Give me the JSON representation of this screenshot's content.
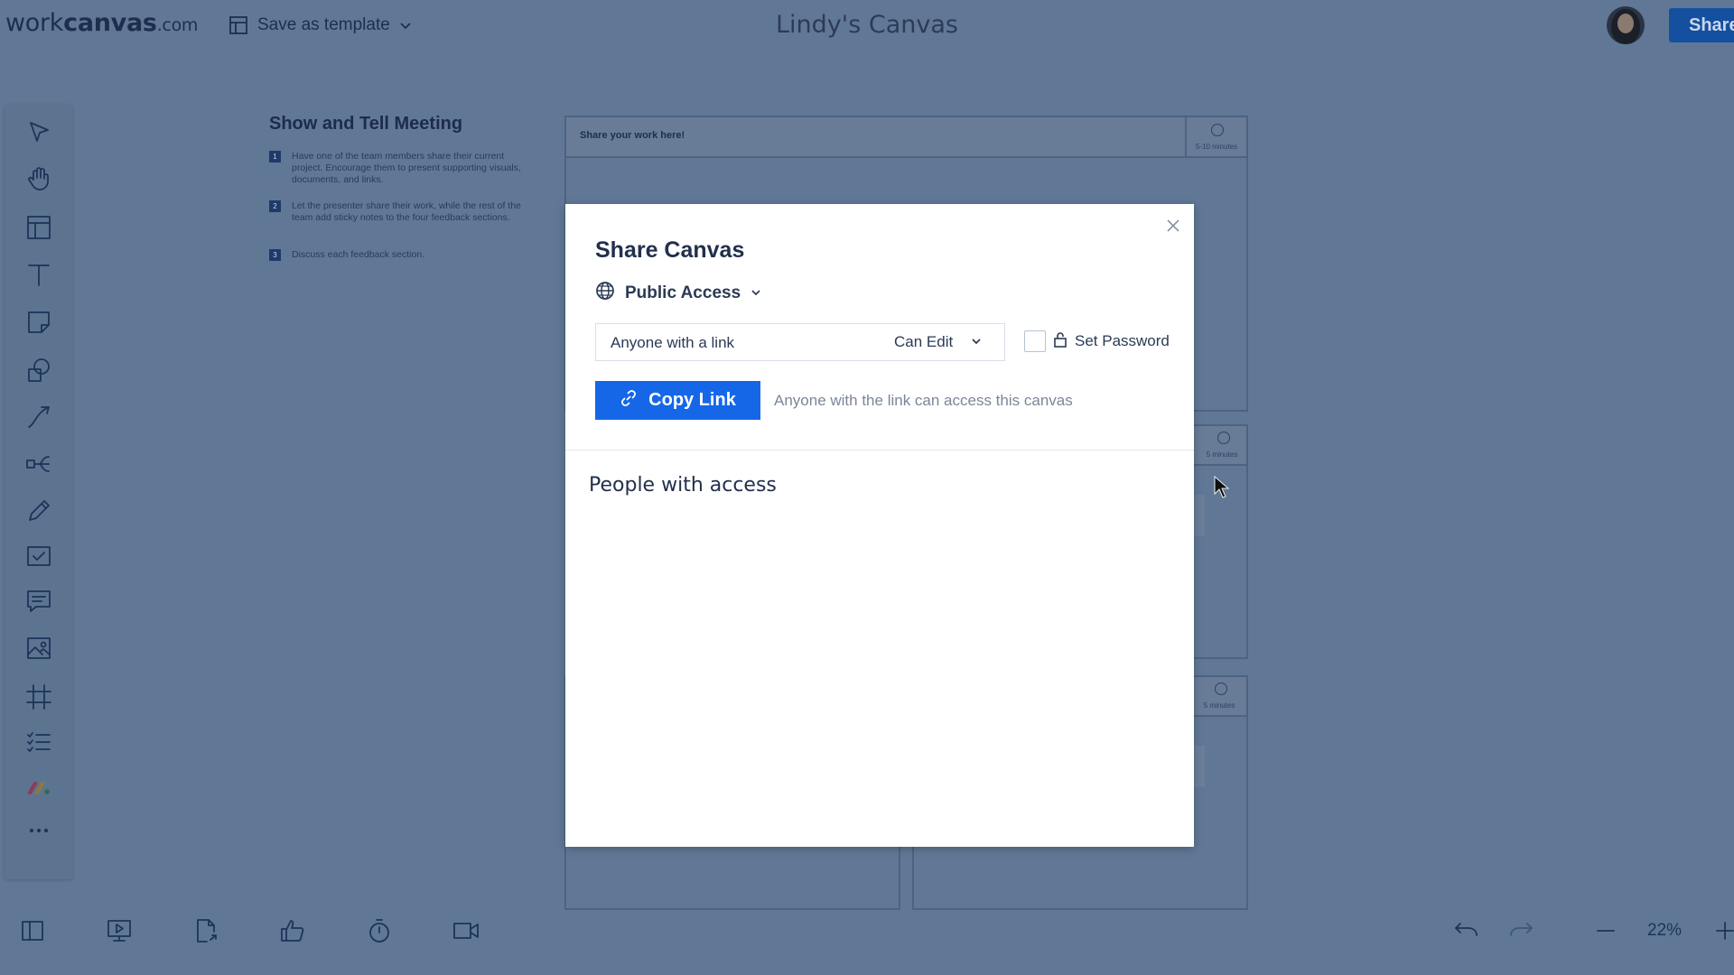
{
  "header": {
    "logo_main": "work",
    "logo_bold": "canvas",
    "logo_domain": ".com",
    "save_template_label": "Save as template",
    "canvas_title": "Lindy's Canvas",
    "share_label": "Share"
  },
  "board": {
    "title": "Show and Tell Meeting",
    "steps": [
      {
        "num": "1",
        "text": "Have one of the team members share their current project. Encourage them to present supporting visuals, documents, and links."
      },
      {
        "num": "2",
        "text": "Let the presenter share their work, while the rest of the team add sticky notes to the four feedback sections."
      },
      {
        "num": "3",
        "text": "Discuss each feedback section."
      }
    ],
    "share_hint": "Share your work here!",
    "timer_1": "5-10 minutes",
    "timer_2": "5 minutes",
    "timer_3": "5 minutes"
  },
  "toolbar": {
    "icons": [
      "select-icon",
      "hand-icon",
      "template-icon",
      "text-icon",
      "sticky-note-icon",
      "shapes-icon",
      "connector-icon",
      "mind-map-icon",
      "pen-icon",
      "task-icon",
      "comment-icon",
      "image-icon",
      "frame-icon",
      "list-icon",
      "apps-icon",
      "more-icon"
    ]
  },
  "bottom": {
    "icons": [
      "panel-icon",
      "present-icon",
      "export-icon",
      "vote-icon",
      "timer-icon",
      "video-icon",
      "undo-icon",
      "redo-icon",
      "zoom-out-icon",
      "zoom-in-icon"
    ],
    "zoom": "22%"
  },
  "modal": {
    "title": "Share Canvas",
    "access_label": "Public Access",
    "link_scope": "Anyone with a link",
    "permission": "Can Edit",
    "password_label": "Set Password",
    "password_checked": false,
    "copy_label": "Copy Link",
    "copy_note": "Anyone with the link can access this canvas",
    "people_heading": "People with access"
  },
  "colors": {
    "accent": "#1567e8",
    "overlay_bg": "#607896",
    "share_button": "#144fa0"
  }
}
